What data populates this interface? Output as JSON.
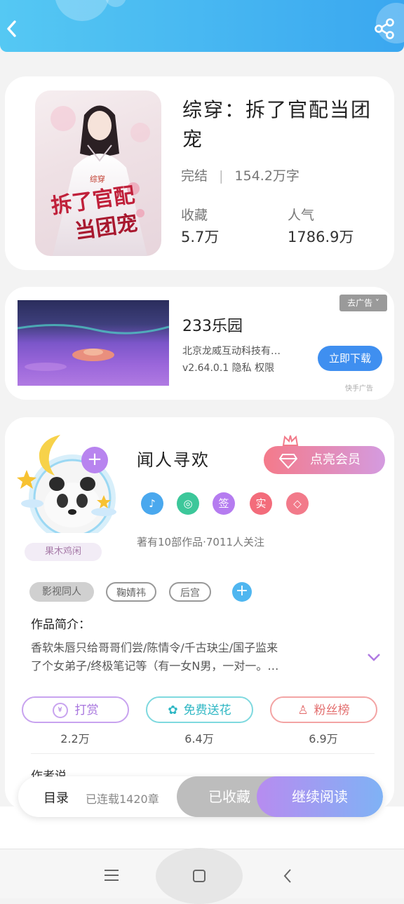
{
  "header": {
    "back_icon": "back-arrow-icon",
    "share_icon": "share-icon"
  },
  "book": {
    "title": "综穿：拆了官配当团宠",
    "status": "完结",
    "separator": "|",
    "word_count": "154.2万字",
    "stats": [
      {
        "label": "收藏",
        "value": "5.7万"
      },
      {
        "label": "人气",
        "value": "1786.9万"
      }
    ],
    "cover_text": {
      "line1": "拆了官配",
      "line2": "当团宠",
      "small": "综穿"
    }
  },
  "ad": {
    "close_tag": "去广告",
    "app_name": "233乐园",
    "company": "北京龙威互动科技有…",
    "version_line": "v2.64.0.1 隐私 权限",
    "download_label": "立即下载",
    "source": "快手广告"
  },
  "author": {
    "name": "闻人寻欢",
    "vip_button": "点亮会员",
    "badges": [
      "",
      "",
      "签",
      "实",
      ""
    ],
    "badge_colors": [
      "#4aa8ee",
      "#3cc79a",
      "#b57cf0",
      "#f36c7b",
      "#f27a8a"
    ],
    "works_info": "著有10部作品·7011人关注",
    "avatar_tag": "果木鸡闲",
    "tags": [
      "影视同人",
      "鞠婧祎",
      "后宫"
    ],
    "intro_label": "作品简介：",
    "intro_line1": "香软朱唇只给哥哥们尝/陈情令/千古玦尘/国子监来",
    "intro_line2": "了个女弟子/终极笔记等（有一女N男，一对一。…",
    "actions": [
      {
        "label": "打赏",
        "value": "2.2万",
        "color": "#b07ae2"
      },
      {
        "label": "免费送花",
        "value": "6.4万",
        "color": "#43c6d2"
      },
      {
        "label": "粉丝榜",
        "value": "6.9万",
        "color": "#f07a7a"
      }
    ],
    "section_peek": "作者说"
  },
  "readbar": {
    "catalog": "目录",
    "chapters": "已连载1420章",
    "collected": "已收藏",
    "continue": "继续阅读"
  },
  "navbar": {
    "menu_icon": "menu-icon",
    "home_icon": "home-icon",
    "back_icon": "back-icon"
  }
}
